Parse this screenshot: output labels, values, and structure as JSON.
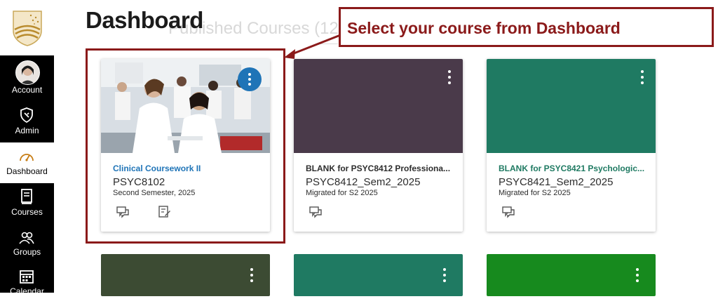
{
  "sidebar": {
    "items": [
      {
        "label": "Account",
        "icon": "avatar"
      },
      {
        "label": "Admin",
        "icon": "shield-icon"
      },
      {
        "label": "Dashboard",
        "icon": "dashboard-icon",
        "active": true
      },
      {
        "label": "Courses",
        "icon": "courses-icon"
      },
      {
        "label": "Groups",
        "icon": "groups-icon"
      },
      {
        "label": "Calendar",
        "icon": "calendar-icon"
      }
    ]
  },
  "header": {
    "title": "Dashboard",
    "subtitle": "Published Courses (12)"
  },
  "callout": {
    "text": "Select your course from Dashboard",
    "color": "#8b1a1a"
  },
  "cards": [
    {
      "title": "Clinical Coursework II",
      "code": "PSYC8102",
      "term": "Second Semester, 2025",
      "color": "#1f74b7",
      "title_color": "#1f74b7",
      "image": true
    },
    {
      "title": "BLANK for PSYC8412 Professiona...",
      "code": "PSYC8412_Sem2_2025",
      "term": "Migrated for S2 2025",
      "color": "#4a3a4a",
      "title_color": "#2d2d2d"
    },
    {
      "title": "BLANK for PSYC8421 Psychologic...",
      "code": "PSYC8421_Sem2_2025",
      "term": "Migrated for S2 2025",
      "color": "#1f7a62",
      "title_color": "#1f7a62"
    }
  ],
  "bottom_cards": [
    {
      "color": "#3c4b33"
    },
    {
      "color": "#1f7a62"
    },
    {
      "color": "#178a1e"
    }
  ]
}
